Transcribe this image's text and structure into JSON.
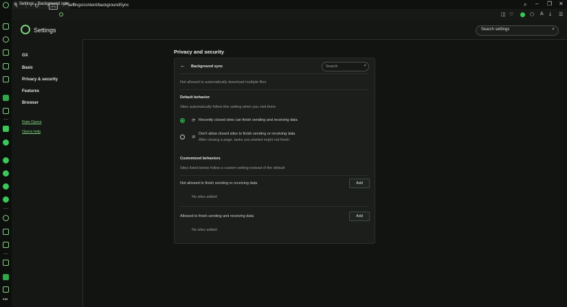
{
  "tab": {
    "title": "Settings - Background sync"
  },
  "address": {
    "vpn_label": "VPN",
    "url": "settings/content/backgroundSync"
  },
  "header": {
    "title": "Settings",
    "search_placeholder": "Search settings"
  },
  "nav": {
    "items": [
      "GX",
      "Basic",
      "Privacy & security",
      "Features",
      "Browser"
    ],
    "links": [
      "Rate Opera",
      "Opera help"
    ]
  },
  "main": {
    "section_title": "Privacy and security",
    "page_title": "Background sync",
    "search_placeholder": "Search",
    "top_text": "Not allowed to automatically download multiple files",
    "default_behavior": {
      "heading": "Default behavior",
      "desc": "Sites automatically follow this setting when you visit them",
      "option1": "Recently closed sites can finish sending and receiving data",
      "option2": "Don't allow closed sites to finish sending or receiving data",
      "option2_sub": "After closing a page, tasks you started might not finish"
    },
    "customized": {
      "heading": "Customized behaviors",
      "desc": "Sites listed below follow a custom setting instead of the default",
      "blocked_label": "Not allowed to finish sending or receiving data",
      "blocked_empty": "No sites added",
      "allowed_label": "Allowed to finish sending and receiving data",
      "allowed_empty": "No sites added",
      "add_label": "Add"
    }
  },
  "colors": {
    "accent": "#39c85a",
    "background": "#121412",
    "card": "#1b1e1b"
  }
}
